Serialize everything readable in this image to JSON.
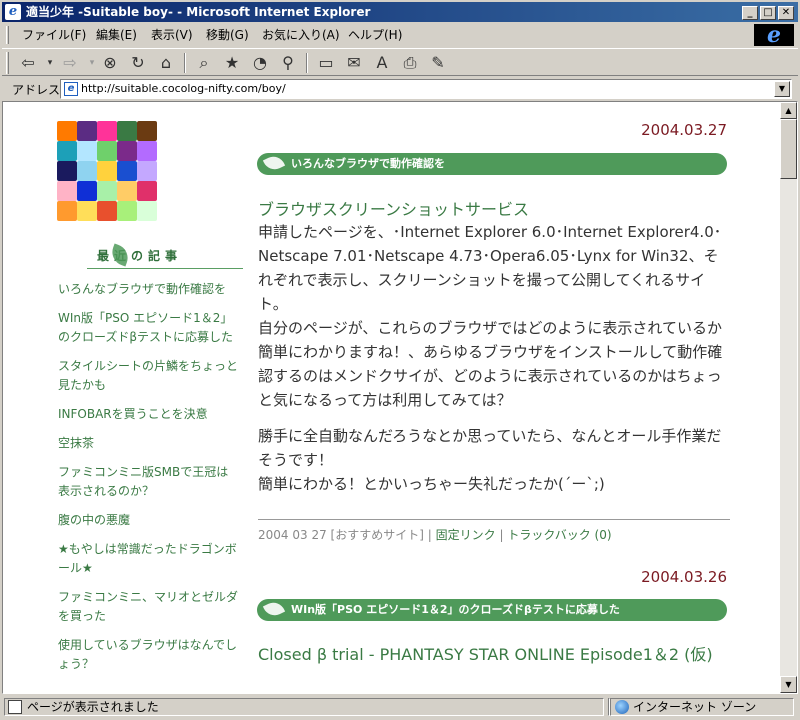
{
  "window": {
    "title": "適当少年 -Suitable boy- - Microsoft Internet Explorer",
    "app_icon": "ie-page-icon",
    "controls": {
      "minimize": "_",
      "maximize": "□",
      "close": "✕"
    }
  },
  "menubar": {
    "items": [
      "ファイル(F)",
      "編集(E)",
      "表示(V)",
      "移動(G)",
      "お気に入り(A)",
      "ヘルプ(H)"
    ]
  },
  "toolbar": {
    "buttons": [
      "back-icon",
      "forward-icon",
      "stop-icon",
      "refresh-icon",
      "home-icon",
      "search-icon",
      "favorites-icon",
      "history-icon",
      "channels-icon",
      "fullscreen-icon",
      "mail-icon",
      "font-icon",
      "print-icon",
      "edit-icon"
    ]
  },
  "addressbar": {
    "label": "アドレス",
    "url": "http://suitable.cocolog-nifty.com/boy/"
  },
  "sidebar": {
    "recent_heading": "最近の記事",
    "recent_items": [
      "いろんなブラウザで動作確認を",
      "WIn版「PSO エピソード1＆2」のクローズドβテストに応募した",
      "スタイルシートの片鱗をちょっと見たかも",
      "INFOBARを買うことを決意",
      "空抹茶",
      "ファミコンミニ版SMBで王冠は表示されるのか？",
      "腹の中の悪魔",
      "★もやしは常識だったドラゴンボール★",
      "ファミコンミニ、マリオとゼルダを買った",
      "使用しているブラウザはなんでしょう？"
    ]
  },
  "entries": [
    {
      "date": "2004.03.27",
      "heading": "いろんなブラウザで動作確認を",
      "title": "ブラウザスクリーンショットサービス",
      "paragraph1": "申請したページを、･Internet Explorer 6.0･Internet Explorer4.0･Netscape 7.01･Netscape 4.73･Opera6.05･Lynx for Win32、それぞれで表示し、スクリーンショットを撮って公開してくれるサイト。",
      "paragraph2": "自分のページが、これらのブラウザではどのように表示されているか簡単にわかりますね！、あらゆるブラウザをインストールして動作確認するのはメンドクサイが、どのように表示されているのかはちょっと気になるって方は利用してみては？",
      "paragraph3": "勝手に全自動なんだろうなとか思っていたら、なんとオール手作業だそうです！",
      "paragraph4": "簡単にわかる！とかいっちゃー失礼だったか(´ー`;)",
      "meta": {
        "date": "2004 03 27",
        "category": "[おすすめサイト]",
        "sep": "|",
        "permalink": "固定リンク",
        "trackback": "トラックバック (0)"
      }
    },
    {
      "date": "2004.03.26",
      "heading": "WIn版「PSO エピソード1＆2」のクローズドβテストに応募した",
      "title": "Closed β trial - PHANTASY STAR ONLINE Episode1＆2 (仮)"
    }
  ],
  "statusbar": {
    "message": "ページが表示されました",
    "zone": "インターネット ゾーン"
  },
  "colors": {
    "accent_green": "#4f9a5a",
    "link_green": "#3a7a44",
    "date_red": "#7b1a22",
    "titlebar": "#0a246a"
  }
}
